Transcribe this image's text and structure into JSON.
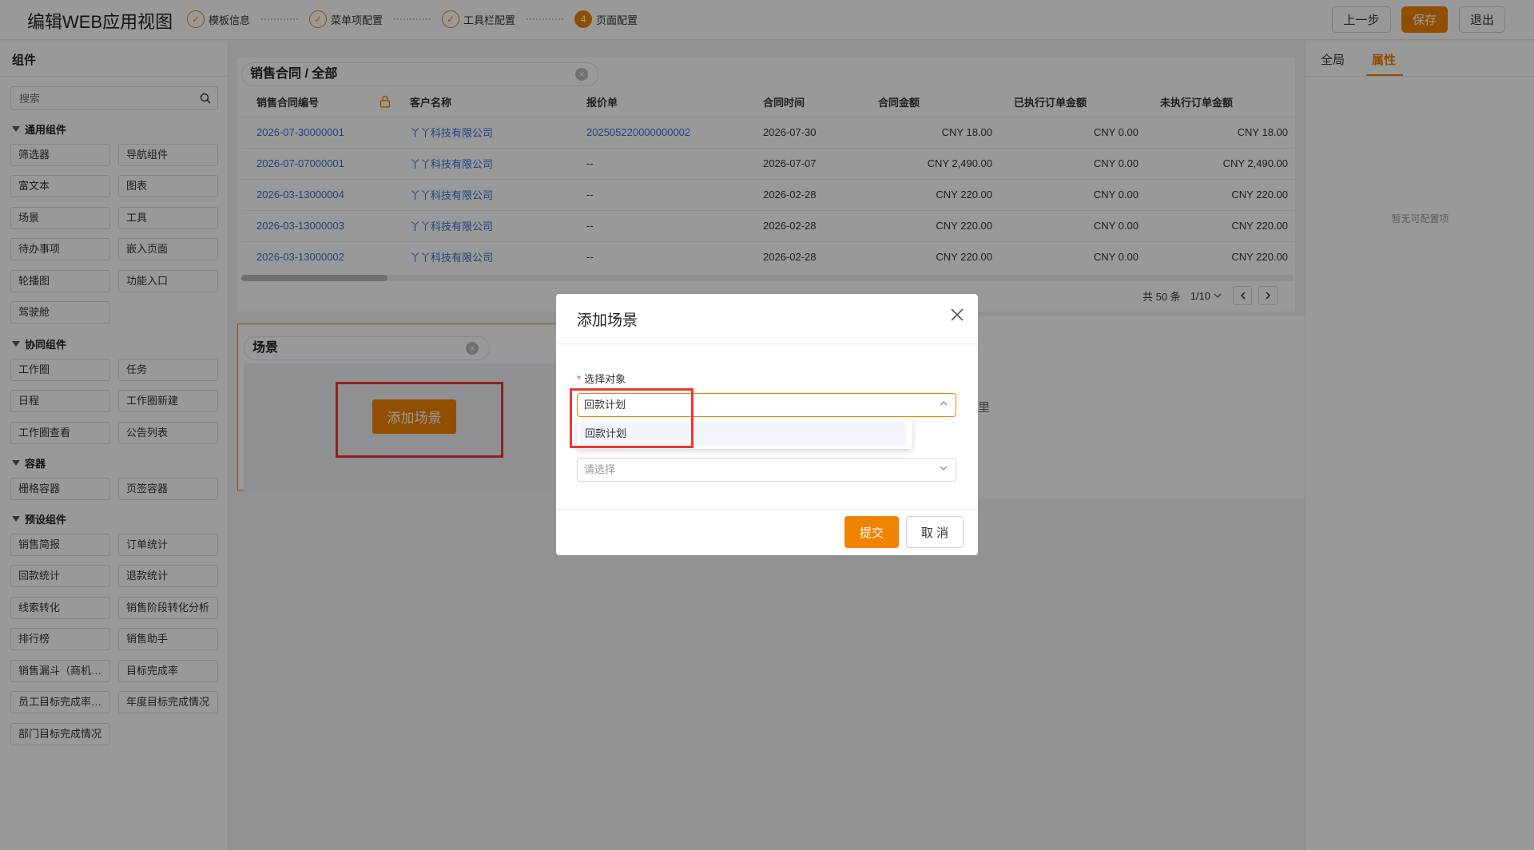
{
  "header": {
    "title": "编辑WEB应用视图",
    "steps": [
      {
        "label": "模板信息",
        "num": "✓"
      },
      {
        "label": "菜单项配置",
        "num": "✓"
      },
      {
        "label": "工具栏配置",
        "num": "✓"
      },
      {
        "label": "页面配置",
        "num": "4"
      }
    ],
    "prev_label": "上一步",
    "save_label": "保存",
    "exit_label": "退出"
  },
  "sidebar": {
    "title": "组件",
    "search_placeholder": "搜索",
    "categories": {
      "common": "通用组件",
      "collab": "协同组件",
      "container": "容器",
      "preset": "预设组件"
    },
    "common": [
      "筛选器",
      "导航组件",
      "富文本",
      "图表",
      "场景",
      "工具",
      "待办事项",
      "嵌入页面",
      "轮播图",
      "功能入口",
      "驾驶舱"
    ],
    "collab": [
      "工作圈",
      "任务",
      "日程",
      "工作圈新建",
      "工作圈查看",
      "公告列表"
    ],
    "container": [
      "栅格容器",
      "页签容器"
    ],
    "preset": [
      "销售简报",
      "订单统计",
      "回款统计",
      "退款统计",
      "线索转化",
      "销售阶段转化分析",
      "排行榜",
      "销售助手",
      "销售漏斗（商机…",
      "目标完成率",
      "员工目标完成率…",
      "年度目标完成情况",
      "部门目标完成情况"
    ]
  },
  "right_panel": {
    "tab_global": "全局",
    "tab_props": "属性",
    "empty_text": "暂无可配置项"
  },
  "table_card": {
    "title": "销售合同 / 全部",
    "columns": [
      "销售合同编号",
      "客户名称",
      "报价单",
      "合同时间",
      "合同金额",
      "已执行订单金额",
      "未执行订单金额"
    ],
    "rows": [
      [
        "2026-07-30000001",
        "丫丫科技有限公司",
        "202505220000000002",
        "2026-07-30",
        "CNY 18.00",
        "CNY 0.00",
        "CNY 18.00"
      ],
      [
        "2026-07-07000001",
        "丫丫科技有限公司",
        "--",
        "2026-07-07",
        "CNY 2,490.00",
        "CNY 0.00",
        "CNY 2,490.00"
      ],
      [
        "2026-03-13000004",
        "丫丫科技有限公司",
        "--",
        "2026-02-28",
        "CNY 220.00",
        "CNY 0.00",
        "CNY 220.00"
      ],
      [
        "2026-03-13000003",
        "丫丫科技有限公司",
        "--",
        "2026-02-28",
        "CNY 220.00",
        "CNY 0.00",
        "CNY 220.00"
      ],
      [
        "2026-03-13000002",
        "丫丫科技有限公司",
        "--",
        "2026-02-28",
        "CNY 220.00",
        "CNY 0.00",
        "CNY 220.00"
      ]
    ],
    "total_text": "共 50 条",
    "page_text": "1/10"
  },
  "scene_card": {
    "title": "场景",
    "add_label": "添加场景",
    "partial_text": "里"
  },
  "modal": {
    "title": "添加场景",
    "field_label": "选择对象",
    "field_value": "回款计划",
    "option": "回款计划",
    "second_placeholder": "请选择",
    "submit_label": "提交",
    "cancel_label": "取 消"
  },
  "colors": {
    "accent": "#f08300",
    "link": "#2f6fd6",
    "highlight": "#ee3535"
  }
}
